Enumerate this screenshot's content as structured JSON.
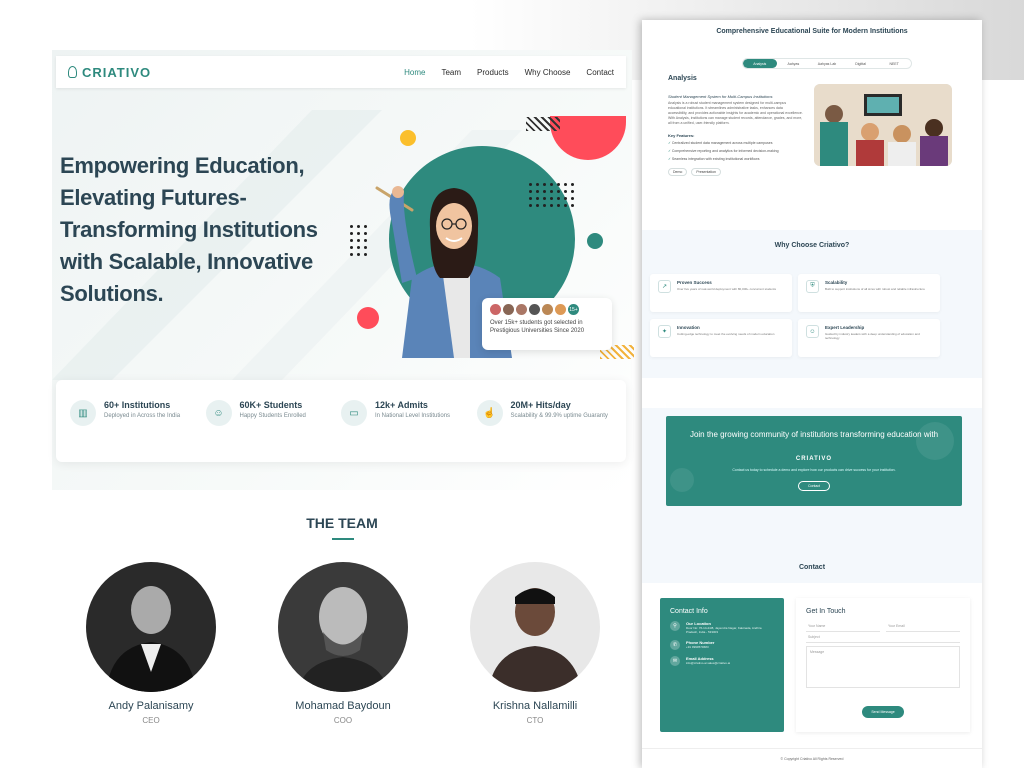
{
  "left_page": {
    "logo": "CRIATIVO",
    "nav": [
      "Home",
      "Team",
      "Products",
      "Why Choose",
      "Contact"
    ],
    "headline": "Empowering Education, Elevating Futures- Transforming Institutions with Scalable, Innovative Solutions.",
    "badge": {
      "count": "15+",
      "text": "Over 15k+ students got selected in Prestigious Universities Since 2020"
    },
    "stats": [
      {
        "value": "60+ Institutions",
        "sub": "Deployed in Across the India",
        "icon": "chart-icon"
      },
      {
        "value": "60K+ Students",
        "sub": "Happy Students Enrolled",
        "icon": "user-icon"
      },
      {
        "value": "12k+ Admits",
        "sub": "In National Level Institutions",
        "icon": "id-card-icon"
      },
      {
        "value": "20M+ Hits/day",
        "sub": "Scalability & 99.9% uptime Guaranty",
        "icon": "hand-icon"
      }
    ],
    "team_title": "THE TEAM",
    "team": [
      {
        "name": "Andy Palanisamy",
        "role": "CEO"
      },
      {
        "name": "Mohamad Baydoun",
        "role": "COO"
      },
      {
        "name": "Krishna Nallamilli",
        "role": "CTO"
      }
    ]
  },
  "right_page": {
    "title": "Comprehensive Educational Suite for Modern Institutions",
    "tabs": [
      "Analysis",
      "Aahyas",
      "Aahyas Lab",
      "Digittal",
      "NEET"
    ],
    "analysis": {
      "title": "Analysis",
      "subtitle": "Student Management System for Multi-Campus Institutions",
      "desc": "Analysis is a robust student management system designed for multi-campus educational institutions. It streamlines administrative tasks, enhances data accessibility, and provides actionable insights for academic and operational excellence. With Analysis, institutions can manage student records, attendance, grades, and more, all from a unified, user-friendly platform.",
      "features_label": "Key Features:",
      "features": [
        "Centralized student data management across multiple campuses",
        "Comprehensive reporting and analytics for informed decision-making",
        "Seamless integration with existing institutional workflows"
      ],
      "chips": [
        "Demo",
        "Presentation"
      ]
    },
    "why_title": "Why Choose Criativo?",
    "why_cards": [
      {
        "title": "Proven Success",
        "desc": "Over five years of real-world deployment with 80,000+ concurrent students",
        "icon": "chart-icon"
      },
      {
        "title": "Scalability",
        "desc": "Built to support institutions of all sizes with robust and reliable infrastructure",
        "icon": "shield-icon"
      },
      {
        "title": "Innovation",
        "desc": "Cutting-edge technology to meet the evolving needs of modern education",
        "icon": "lightbulb-icon"
      },
      {
        "title": "Expert Leadership",
        "desc": "Guided by industry leaders with a deep understanding of education and technology",
        "icon": "user-icon"
      }
    ],
    "join": {
      "title": "Join the growing community of institutions transforming education with",
      "logo": "CRIATIVO",
      "sub": "Contact us today to schedule a demo and explore how our products can drive success for your institution.",
      "button": "Contact"
    },
    "contact_title": "Contact",
    "contact_info": {
      "title": "Contact Info",
      "items": [
        {
          "label": "Our Location",
          "value": "Door No: 76-14-24/8, Jayendra Nagar, Kakinada, Andhra Pradesh, India - 533003",
          "icon": "pin-icon"
        },
        {
          "label": "Phone Number",
          "value": "+91 9999579683",
          "icon": "phone-icon"
        },
        {
          "label": "Email Address",
          "value": "info@criativo.ai sales@criativo.ai",
          "icon": "mail-icon"
        }
      ]
    },
    "get_in_touch": {
      "title": "Get In Touch",
      "name_ph": "Your Name",
      "email_ph": "Your Email",
      "subject_ph": "Subject",
      "message_ph": "Message",
      "button": "Send Message"
    },
    "footer": "© Copyright Criativo All Rights Reserved"
  },
  "colors": {
    "teal": "#2e8a7e",
    "red": "#ff4c5a",
    "yellow": "#fbbf2c",
    "navy": "#2c4654"
  }
}
